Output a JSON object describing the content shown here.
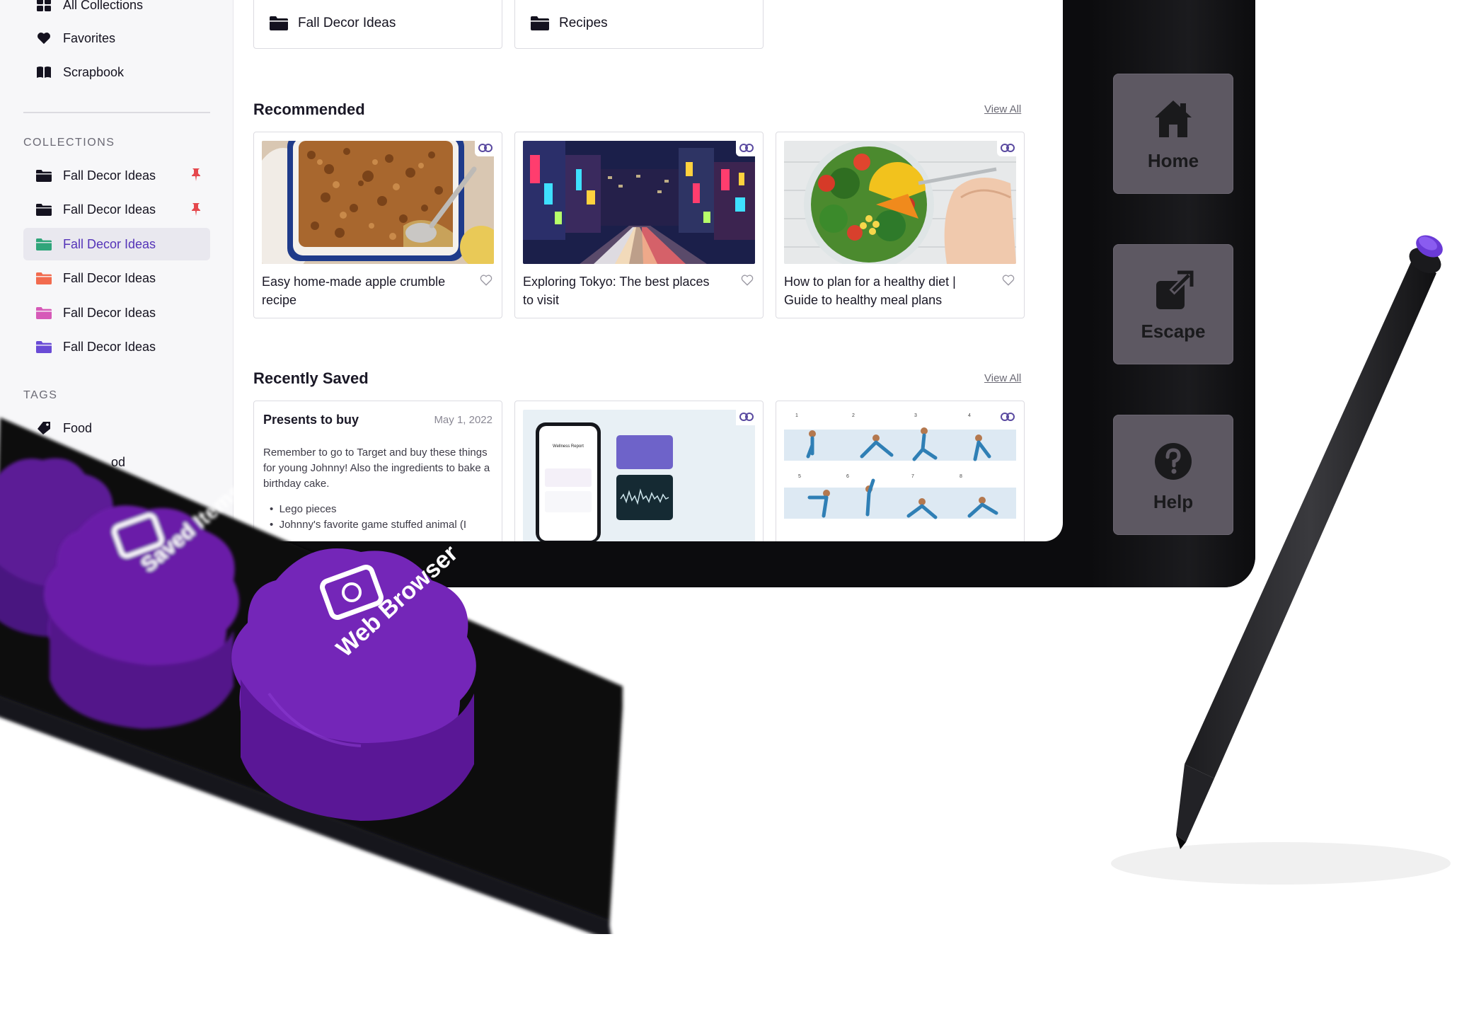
{
  "sidebar": {
    "top_items": [
      {
        "label": "All Collections",
        "icon": "grid-icon"
      },
      {
        "label": "Favorites",
        "icon": "heart-icon"
      },
      {
        "label": "Scrapbook",
        "icon": "book-icon"
      }
    ],
    "collections_heading": "COLLECTIONS",
    "collections": [
      {
        "label": "Fall Decor Ideas",
        "color": "#14121f",
        "pinned": true
      },
      {
        "label": "Fall Decor Ideas",
        "color": "#14121f",
        "pinned": true
      },
      {
        "label": "Fall Decor Ideas",
        "color": "#2fa57a",
        "active": true
      },
      {
        "label": "Fall Decor Ideas",
        "color": "#f26b4f"
      },
      {
        "label": "Fall Decor Ideas",
        "color": "#d65ab8"
      },
      {
        "label": "Fall Decor Ideas",
        "color": "#6a4bd6"
      }
    ],
    "tags_heading": "TAGS",
    "tags": [
      {
        "label": "Food"
      },
      {
        "label": "od"
      }
    ]
  },
  "folders": [
    {
      "label": "Fall Decor Ideas"
    },
    {
      "label": "Recipes"
    }
  ],
  "recommended": {
    "title": "Recommended",
    "view_all": "View All",
    "cards": [
      {
        "title": "Easy home-made apple crumble recipe"
      },
      {
        "title": "Exploring Tokyo: The best places to visit"
      },
      {
        "title": "How to plan for a healthy diet | Guide to healthy meal plans"
      }
    ]
  },
  "recently_saved": {
    "title": "Recently Saved",
    "view_all": "View All",
    "note": {
      "title": "Presents to buy",
      "date": "May 1, 2022",
      "body": "Remember to go to Target and buy these things for young Johnny! Also the ingredients to bake a birthday cake.",
      "bullets": [
        "Lego pieces",
        "Johnny's favorite game stuffed animal (I"
      ]
    },
    "phone_card": {
      "report_title": "Wellness Report"
    },
    "yoga_card": {
      "poses": [
        "1",
        "2",
        "3",
        "4",
        "5",
        "6",
        "7",
        "8"
      ]
    }
  },
  "hardware_buttons": [
    {
      "label": "Home",
      "icon": "home-icon"
    },
    {
      "label": "Escape",
      "icon": "external-link-icon"
    },
    {
      "label": "Help",
      "icon": "help-icon"
    }
  ],
  "dock": {
    "knobs": [
      {
        "label": ""
      },
      {
        "label": "Saved Items"
      },
      {
        "label": "Web Browser"
      }
    ]
  },
  "colors": {
    "accent": "#5433b8",
    "knob_purple": "#6a1fa8",
    "pin_red": "#e5484d"
  }
}
